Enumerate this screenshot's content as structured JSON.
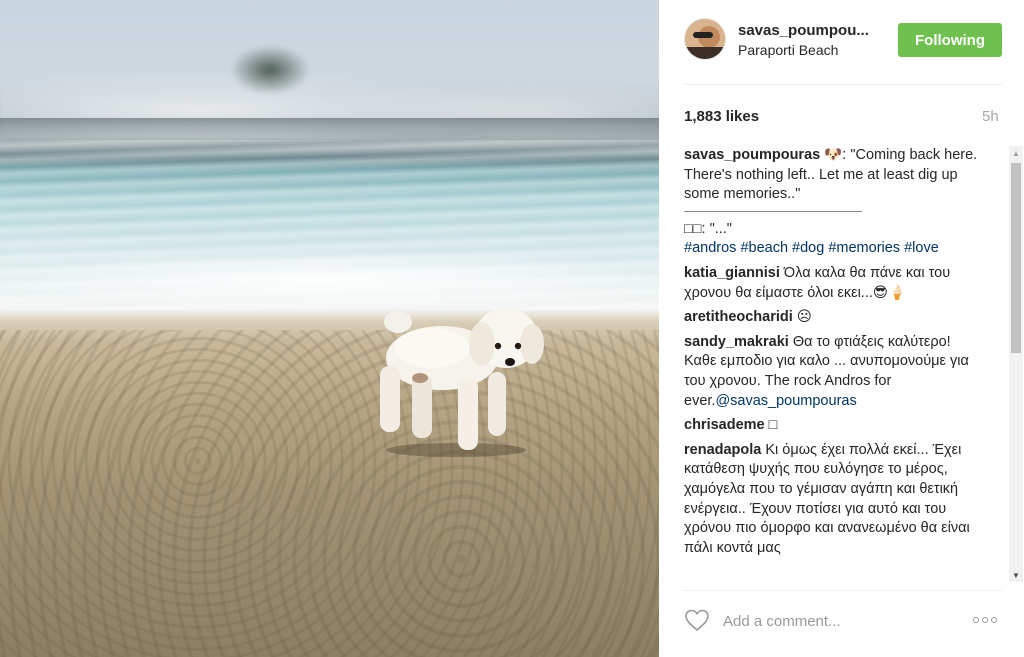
{
  "post": {
    "username": "savas_poumpou...",
    "location": "Paraporti Beach",
    "follow_label": "Following",
    "likes": "1,883 likes",
    "time": "5h"
  },
  "caption": {
    "user": "savas_poumpouras",
    "text": " 🐶: \"Coming back here. There's nothing left.. Let me at least dig up some memories..\"",
    "reply": "□□: \"...\"",
    "hashtags": [
      "#andros",
      "#beach",
      "#dog",
      "#memories",
      "#love"
    ]
  },
  "comments": [
    {
      "user": "katia_giannisi",
      "text": " Όλα καλα θα πάνε και του χρονου θα είμαστε όλοι εκει...😎🍦"
    },
    {
      "user": "aretitheocharidi",
      "text": " ☹"
    },
    {
      "user": "sandy_makraki",
      "text": " Θα το φτιάξεις καλύτερο! Καθε εμποδιο για καλο ... ανυπομονούμε για του χρονου. The rock Andros for ever.",
      "mention": "@savas_poumpouras"
    },
    {
      "user": "chrisademe",
      "text": " □"
    },
    {
      "user": "renadapola",
      "text": " Κι όμως έχει πολλά εκεί... Έχει κατάθεση ψυχής που ευλόγησε το μέρος, χαμόγελα που το γέμισαν αγάπη και θετική ενέργεια.. Έχουν ποτίσει για αυτό και του χρόνου πιο όμορφο και ανανεωμένο θα είναι πάλι κοντά μας"
    }
  ],
  "comment_box": {
    "placeholder": "Add a comment..."
  },
  "icons": {
    "heart": "heart-icon",
    "more": "more-options-icon",
    "scroll_up": "▲",
    "scroll_down": "▼"
  },
  "colors": {
    "follow_bg": "#70c050",
    "link": "#003569",
    "muted": "#a5a7aa"
  }
}
